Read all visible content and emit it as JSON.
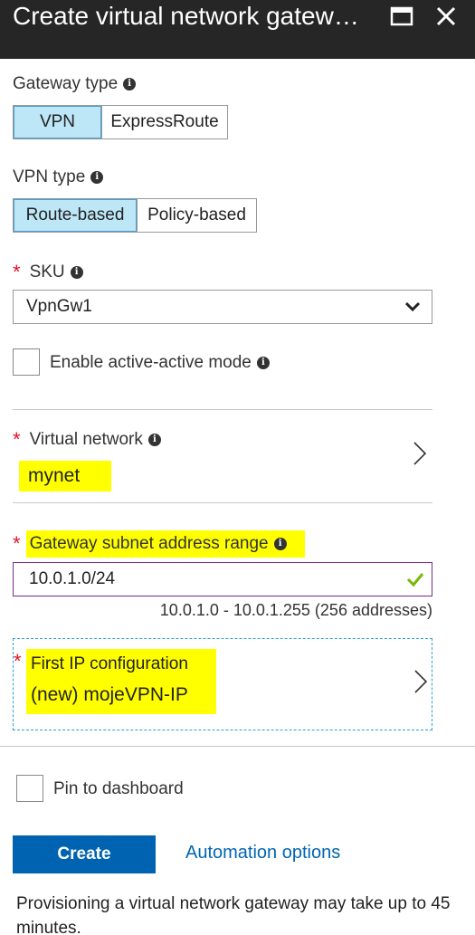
{
  "window": {
    "title": "Create virtual network gatew…",
    "maximize_icon": "maximize-icon",
    "close_icon": "close-icon"
  },
  "gateway_type": {
    "label": "Gateway type",
    "options": [
      "VPN",
      "ExpressRoute"
    ],
    "selected": "VPN"
  },
  "vpn_type": {
    "label": "VPN type",
    "options": [
      "Route-based",
      "Policy-based"
    ],
    "selected": "Route-based"
  },
  "sku": {
    "required_mark": "*",
    "label": "SKU",
    "value": "VpnGw1"
  },
  "active_active": {
    "label": "Enable active-active mode",
    "checked": false
  },
  "virtual_network": {
    "required_mark": "*",
    "label": "Virtual network",
    "value": "mynet"
  },
  "gateway_subnet": {
    "required_mark": "*",
    "label": "Gateway subnet address range",
    "value": "10.0.1.0/24",
    "hint": "10.0.1.0 - 10.0.1.255 (256 addresses)"
  },
  "ip_configuration": {
    "required_mark": "*",
    "label": "First IP configuration",
    "value": "(new) mojeVPN-IP"
  },
  "pin_to_dashboard": {
    "label": "Pin to dashboard",
    "checked": false
  },
  "actions": {
    "create_label": "Create",
    "automation_label": "Automation options"
  },
  "note": "Provisioning a virtual network gateway may take up to 45 minutes.",
  "colors": {
    "titlebar": "#262626",
    "selected_option": "#bde6f6",
    "highlight": "#ffff00",
    "primary_button": "#0063b1",
    "link": "#0066b3",
    "required": "#e81123",
    "valid_check": "#7ab800"
  }
}
